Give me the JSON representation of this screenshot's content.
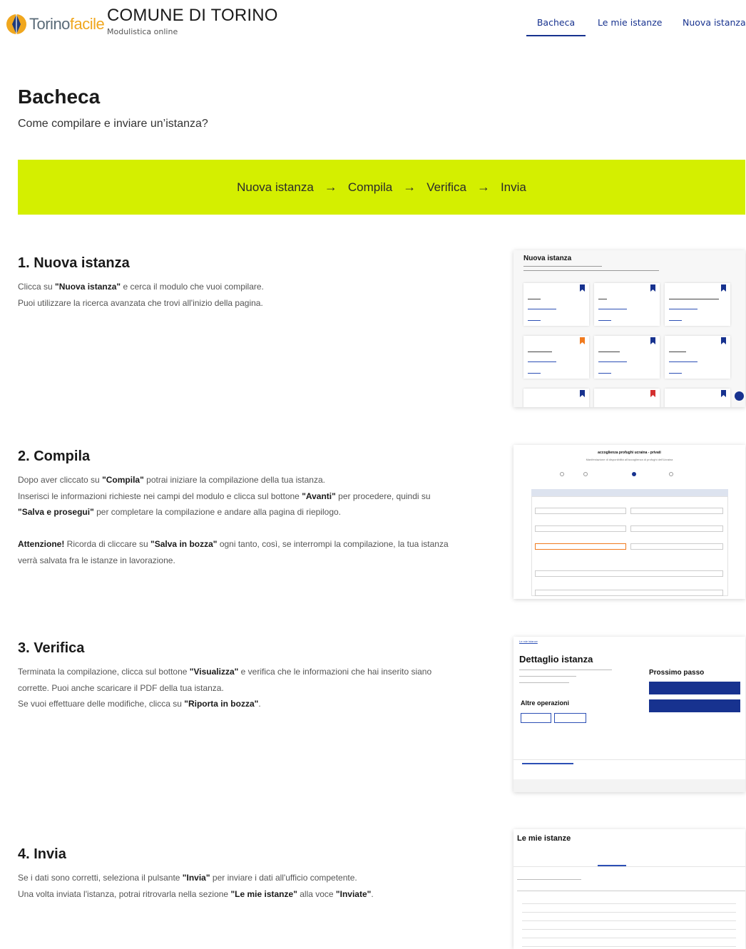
{
  "header": {
    "logo_part1": "Torino",
    "logo_part2": "facile",
    "org_name": "COMUNE DI TORINO",
    "org_subtitle": "Modulistica online",
    "nav": [
      {
        "label": "Bacheca",
        "active": true
      },
      {
        "label": "Le mie istanze",
        "active": false
      },
      {
        "label": "Nuova istanza",
        "active": false
      }
    ]
  },
  "page": {
    "title": "Bacheca",
    "subtitle": "Come compilare e inviare un’istanza?"
  },
  "banner": {
    "steps": [
      "Nuova istanza",
      "Compila",
      "Verifica",
      "Invia"
    ],
    "separator": "→"
  },
  "sections": [
    {
      "title": "1. Nuova istanza",
      "lines": [
        [
          "Clicca su ",
          "Nuova istanza",
          " e cerca il modulo che vuoi compilare."
        ],
        [
          "Puoi utilizzare la ricerca avanzata che trovi all'inizio della pagina."
        ]
      ]
    },
    {
      "title": "2. Compila",
      "p1_a": "Dopo aver cliccato su ",
      "p1_b": "Compila",
      "p1_c": " potrai iniziare la compilazione della tua istanza.",
      "p2_a": "Inserisci le informazioni richieste nei campi del modulo e clicca sul bottone ",
      "p2_b": "Avanti",
      "p2_c": " per procedere, quindi su",
      "p3_a": "Salva e prosegui",
      "p3_b": " per completare la compilazione e andare alla pagina di riepilogo.",
      "p4_a": "Attenzione!",
      "p4_b": " Ricorda di cliccare su ",
      "p4_c": "Salva in bozza",
      "p4_d": " ogni tanto, così, se interrompi la compilazione, la tua istanza",
      "p5": "verrà salvata fra le istanze in lavorazione."
    },
    {
      "title": "3. Verifica",
      "p1_a": "Terminata la compilazione, clicca sul bottone ",
      "p1_b": "Visualizza",
      "p1_c": " e verifica che le informazioni che hai inserito siano",
      "p2": "corrette. Puoi anche scaricare il PDF della tua istanza.",
      "p3_a": "Se vuoi effettuare delle modifiche, clicca su ",
      "p3_b": "Riporta in bozza",
      "p3_c": "."
    },
    {
      "title": "4. Invia",
      "p1_a": "Se i dati sono corretti, seleziona il pulsante ",
      "p1_b": "Invia",
      "p1_c": " per inviare i dati all'ufficio competente.",
      "p2_a": "Una volta inviata l'istanza, potrai ritrovarla nella sezione ",
      "p2_b": "Le mie istanze",
      "p2_c": " alla voce ",
      "p2_d": "Inviate",
      "p2_e": "."
    }
  ],
  "thumbs": {
    "t1_title": "Nuova istanza",
    "t2_title": "accoglienza profughi ucraina - privati",
    "t2_sub": "Manifestazione di disponibilità all'accoglienza di profughi dell'Ucraina",
    "t3_breadcrumb": "Le mie istanze",
    "t3_title": "Dettaglio istanza",
    "t3_next": "Prossimo passo",
    "t3_other": "Altre operazioni",
    "t4_title": "Le mie istanze"
  },
  "colors": {
    "accent_blue": "#17328f",
    "banner_green": "#d4ef00",
    "logo_orange": "#f0a71e"
  }
}
